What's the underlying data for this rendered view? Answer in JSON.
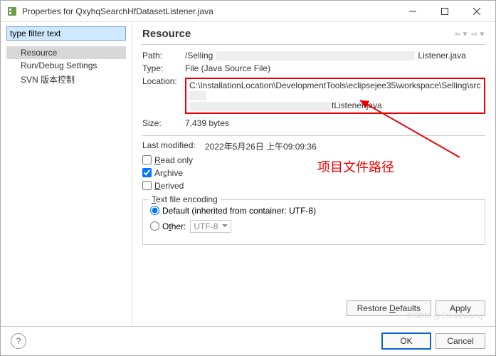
{
  "titlebar": {
    "title": "Properties for QxyhqSearchHfDatasetListener.java"
  },
  "sidebar": {
    "filter_placeholder": "type filter text",
    "items": [
      {
        "label": "Resource"
      },
      {
        "label": "Run/Debug Settings"
      },
      {
        "label": "SVN 版本控制"
      }
    ]
  },
  "main": {
    "heading": "Resource",
    "path_label": "Path:",
    "path_value_prefix": "/Selling",
    "path_value_suffix": "Listener.java",
    "type_label": "Type:",
    "type_value": "File  (Java Source File)",
    "location_label": "Location:",
    "location_line1": "C:\\InstallationLocation\\DevelopmentTools\\eclipsejee35\\workspace\\Selling\\src",
    "location_line2_suffix": "tListener.java",
    "size_label": "Size:",
    "size_value": "7,439  bytes",
    "last_modified_label": "Last modified:",
    "last_modified_value": "2022年5月26日 上午09:09:36",
    "read_only_label": "Read only",
    "archive_label": "Archive",
    "derived_label": "Derived",
    "encoding_group_label": "Text file encoding",
    "encoding_default_label": "Default (inherited from container: UTF-8)",
    "encoding_other_label": "Other:",
    "encoding_other_value": "UTF-8",
    "restore_btn": "Restore Defaults",
    "apply_btn": "Apply"
  },
  "footer": {
    "ok": "OK",
    "cancel": "Cancel"
  },
  "annotation": {
    "label": "项目文件路径"
  },
  "watermark": "CSDN @Stevewang"
}
